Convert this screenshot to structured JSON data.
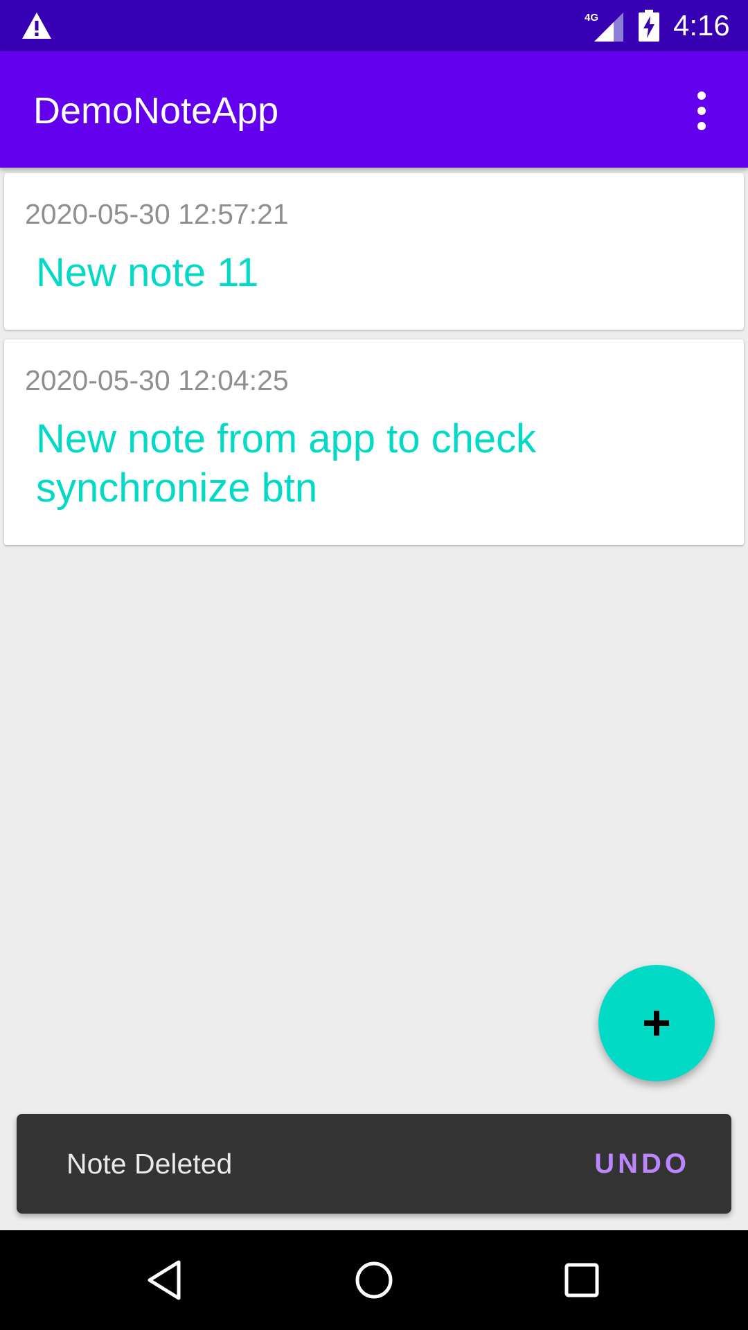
{
  "status_bar": {
    "time": "4:16",
    "network": "4G",
    "icons": [
      "warning-icon",
      "signal-icon",
      "battery-charging-icon"
    ]
  },
  "app_bar": {
    "title": "DemoNoteApp",
    "overflow_icon": "more-vert-icon"
  },
  "notes": [
    {
      "date": "2020-05-30 12:57:21",
      "title": "New note 11"
    },
    {
      "date": "2020-05-30 12:04:25",
      "title": "New note from app to check synchronize btn"
    }
  ],
  "fab": {
    "icon": "plus-icon"
  },
  "snackbar": {
    "message": "Note Deleted",
    "action": "UNDO"
  },
  "nav_bar": {
    "icons": [
      "back-icon",
      "home-icon",
      "recents-icon"
    ]
  },
  "colors": {
    "status_bar": "#3700b3",
    "app_bar": "#6200ee",
    "accent": "#03dac5",
    "snackbar_action": "#bb86fc",
    "background": "#ededed"
  }
}
